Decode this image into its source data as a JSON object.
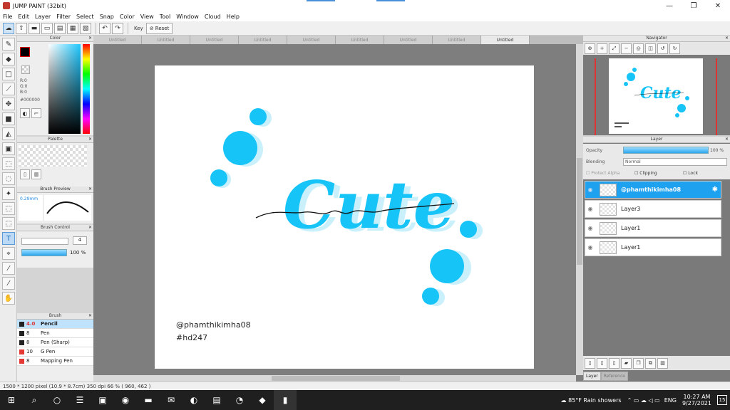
{
  "window": {
    "title": "JUMP PAINT (32bit)"
  },
  "menu": [
    "File",
    "Edit",
    "Layer",
    "Filter",
    "Select",
    "Snap",
    "Color",
    "View",
    "Tool",
    "Window",
    "Cloud",
    "Help"
  ],
  "toolbar": {
    "key_label": "Key",
    "reset_label": "Reset"
  },
  "panels": {
    "color": {
      "title": "Color",
      "r": "R:0",
      "g": "G:0",
      "b": "B:0",
      "hex": "#000000"
    },
    "palette": {
      "title": "Palette"
    },
    "brush_preview": {
      "title": "Brush Preview",
      "size": "0.29mm"
    },
    "brush_control": {
      "title": "Brush Control",
      "size_value": "4",
      "opacity_value": "100 %"
    },
    "brush": {
      "title": "Brush",
      "items": [
        {
          "size": "4.0",
          "name": "Pencil",
          "color": "#222222"
        },
        {
          "size": "8",
          "name": "Pen",
          "color": "#222222"
        },
        {
          "size": "8",
          "name": "Pen (Sharp)",
          "color": "#222222"
        },
        {
          "size": "10",
          "name": "G Pen",
          "color": "#e53935"
        },
        {
          "size": "8",
          "name": "Mapping Pen",
          "color": "#e53935"
        }
      ]
    }
  },
  "tabs": [
    "Untitled",
    "Untitled",
    "Untitled",
    "Untitled",
    "Untitled",
    "Untitled",
    "Untitled",
    "Untitled",
    "Untitled"
  ],
  "canvas": {
    "watermark_line1": "@phamthikimha08",
    "watermark_line2": "#hd247",
    "word": "Cute",
    "accent_color": "#1ec8ff"
  },
  "navigator": {
    "title": "Navigator"
  },
  "layer_panel": {
    "title": "Layer",
    "opacity_label": "Opacity",
    "opacity_value": "100 %",
    "blending_label": "Blending",
    "blending_value": "Normal",
    "protect_alpha": "Protect Alpha",
    "clipping": "Clipping",
    "lock": "Lock",
    "layers": [
      "@phamthikimha08",
      "Layer3",
      "Layer1",
      "Layer1"
    ],
    "tab_layer": "Layer",
    "tab_reference": "Reference"
  },
  "status": "1500 * 1200 pixel   (10.9 * 8.7cm)   350 dpi   66 %   ( 960, 462 )",
  "taskbar": {
    "weather": "85°F  Rain showers",
    "lang": "ENG",
    "time": "10:27 AM",
    "date": "9/27/2021",
    "notif": "15"
  }
}
